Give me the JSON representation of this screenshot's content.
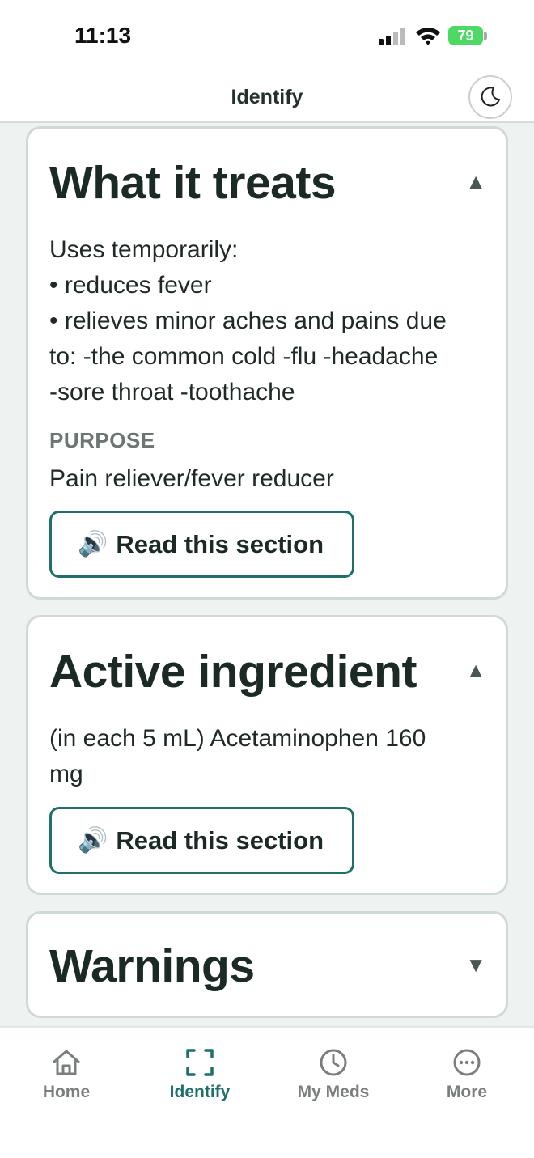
{
  "status_bar": {
    "time": "11:13",
    "battery": "79"
  },
  "header": {
    "title": "Identify",
    "theme_icon": "moon-icon"
  },
  "sections": [
    {
      "title": "What it treats",
      "expanded": true,
      "body_lines": [
        "Uses temporarily:",
        "• reduces fever",
        "• relieves minor aches and pains due",
        "to: -the common cold -flu -headache",
        "-sore throat -toothache"
      ],
      "purpose_label": "PURPOSE",
      "purpose_text": "Pain reliever/fever reducer",
      "read_button": "Read this section"
    },
    {
      "title": "Active ingredient",
      "expanded": true,
      "body_lines": [
        "(in each 5 mL) Acetaminophen 160",
        "mg"
      ],
      "read_button": "Read this section"
    },
    {
      "title": "Warnings",
      "expanded": false
    }
  ],
  "bottom_nav": {
    "items": [
      {
        "label": "Home",
        "icon": "home-icon",
        "active": false
      },
      {
        "label": "Identify",
        "icon": "scan-icon",
        "active": true
      },
      {
        "label": "My Meds",
        "icon": "clock-icon",
        "active": false
      },
      {
        "label": "More",
        "icon": "more-icon",
        "active": false
      }
    ]
  },
  "colors": {
    "accent": "#1f6f6a",
    "background": "#eef2f1",
    "card_border": "#cfd9d6"
  }
}
